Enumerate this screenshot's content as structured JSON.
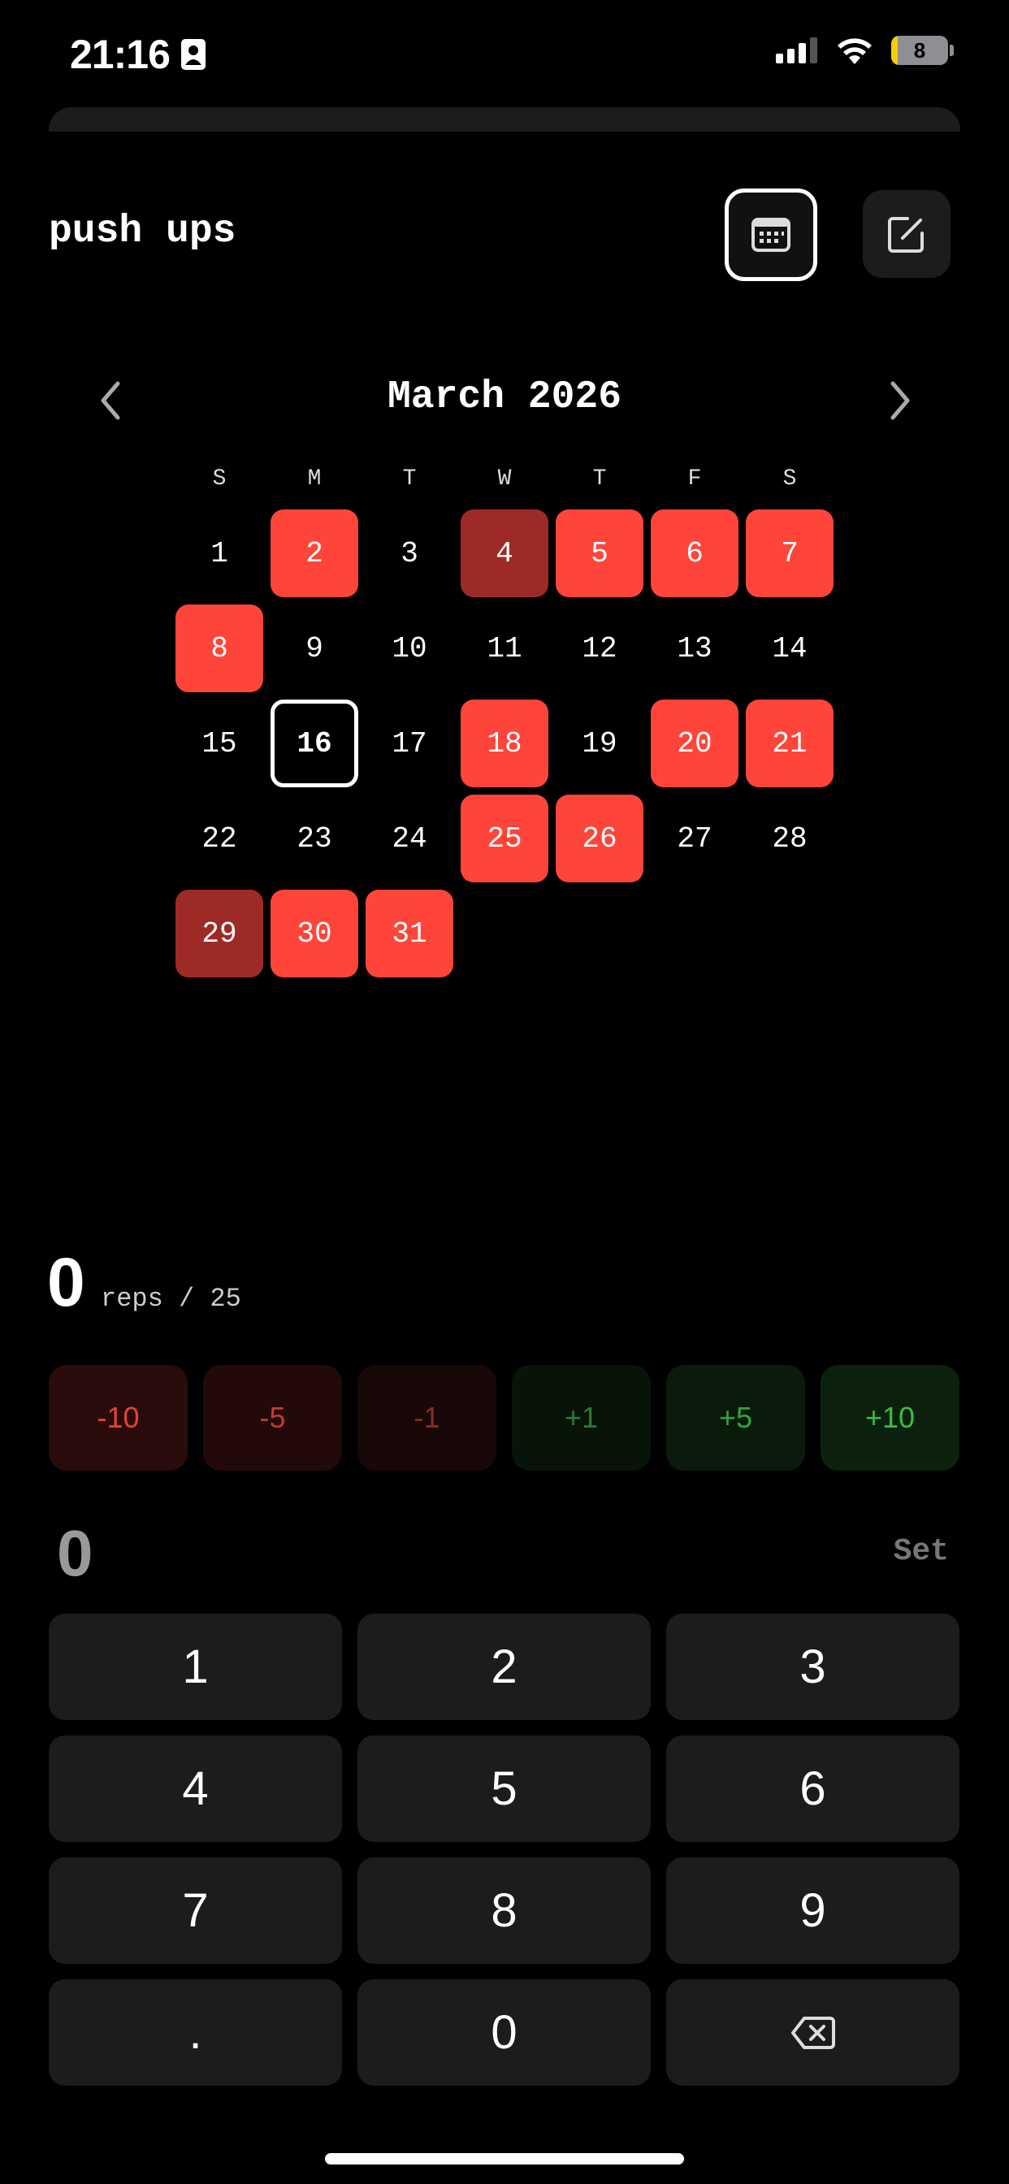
{
  "status_bar": {
    "time": "21:16",
    "battery": "8"
  },
  "header": {
    "title": "push ups"
  },
  "calendar": {
    "month_label": "March 2026",
    "weekdays": [
      "S",
      "M",
      "T",
      "W",
      "T",
      "F",
      "S"
    ],
    "days": [
      {
        "label": "1",
        "state": "none"
      },
      {
        "label": "2",
        "state": "done"
      },
      {
        "label": "3",
        "state": "none"
      },
      {
        "label": "4",
        "state": "partial"
      },
      {
        "label": "5",
        "state": "done"
      },
      {
        "label": "6",
        "state": "done"
      },
      {
        "label": "7",
        "state": "done"
      },
      {
        "label": "8",
        "state": "done"
      },
      {
        "label": "9",
        "state": "none"
      },
      {
        "label": "10",
        "state": "none"
      },
      {
        "label": "11",
        "state": "none"
      },
      {
        "label": "12",
        "state": "none"
      },
      {
        "label": "13",
        "state": "none"
      },
      {
        "label": "14",
        "state": "none"
      },
      {
        "label": "15",
        "state": "none"
      },
      {
        "label": "16",
        "state": "today"
      },
      {
        "label": "17",
        "state": "none"
      },
      {
        "label": "18",
        "state": "done"
      },
      {
        "label": "19",
        "state": "none"
      },
      {
        "label": "20",
        "state": "done"
      },
      {
        "label": "21",
        "state": "done"
      },
      {
        "label": "22",
        "state": "none"
      },
      {
        "label": "23",
        "state": "none"
      },
      {
        "label": "24",
        "state": "none"
      },
      {
        "label": "25",
        "state": "done"
      },
      {
        "label": "26",
        "state": "done"
      },
      {
        "label": "27",
        "state": "none"
      },
      {
        "label": "28",
        "state": "none"
      },
      {
        "label": "29",
        "state": "partial"
      },
      {
        "label": "30",
        "state": "done"
      },
      {
        "label": "31",
        "state": "done"
      }
    ]
  },
  "progress": {
    "count": "0",
    "label": "reps / 25"
  },
  "adjust_buttons": [
    {
      "label": "-10",
      "kind": "m10"
    },
    {
      "label": "-5",
      "kind": "m5"
    },
    {
      "label": "-1",
      "kind": "m1"
    },
    {
      "label": "+1",
      "kind": "p1"
    },
    {
      "label": "+5",
      "kind": "p5"
    },
    {
      "label": "+10",
      "kind": "p10"
    }
  ],
  "entry": {
    "value": "0",
    "set_label": "Set"
  },
  "keypad": [
    "1",
    "2",
    "3",
    "4",
    "5",
    "6",
    "7",
    "8",
    "9",
    ".",
    "0",
    "backspace"
  ],
  "colors": {
    "done": "#ff453a",
    "partial": "#9e2a26",
    "background": "#000000",
    "key": "#1c1c1e"
  }
}
